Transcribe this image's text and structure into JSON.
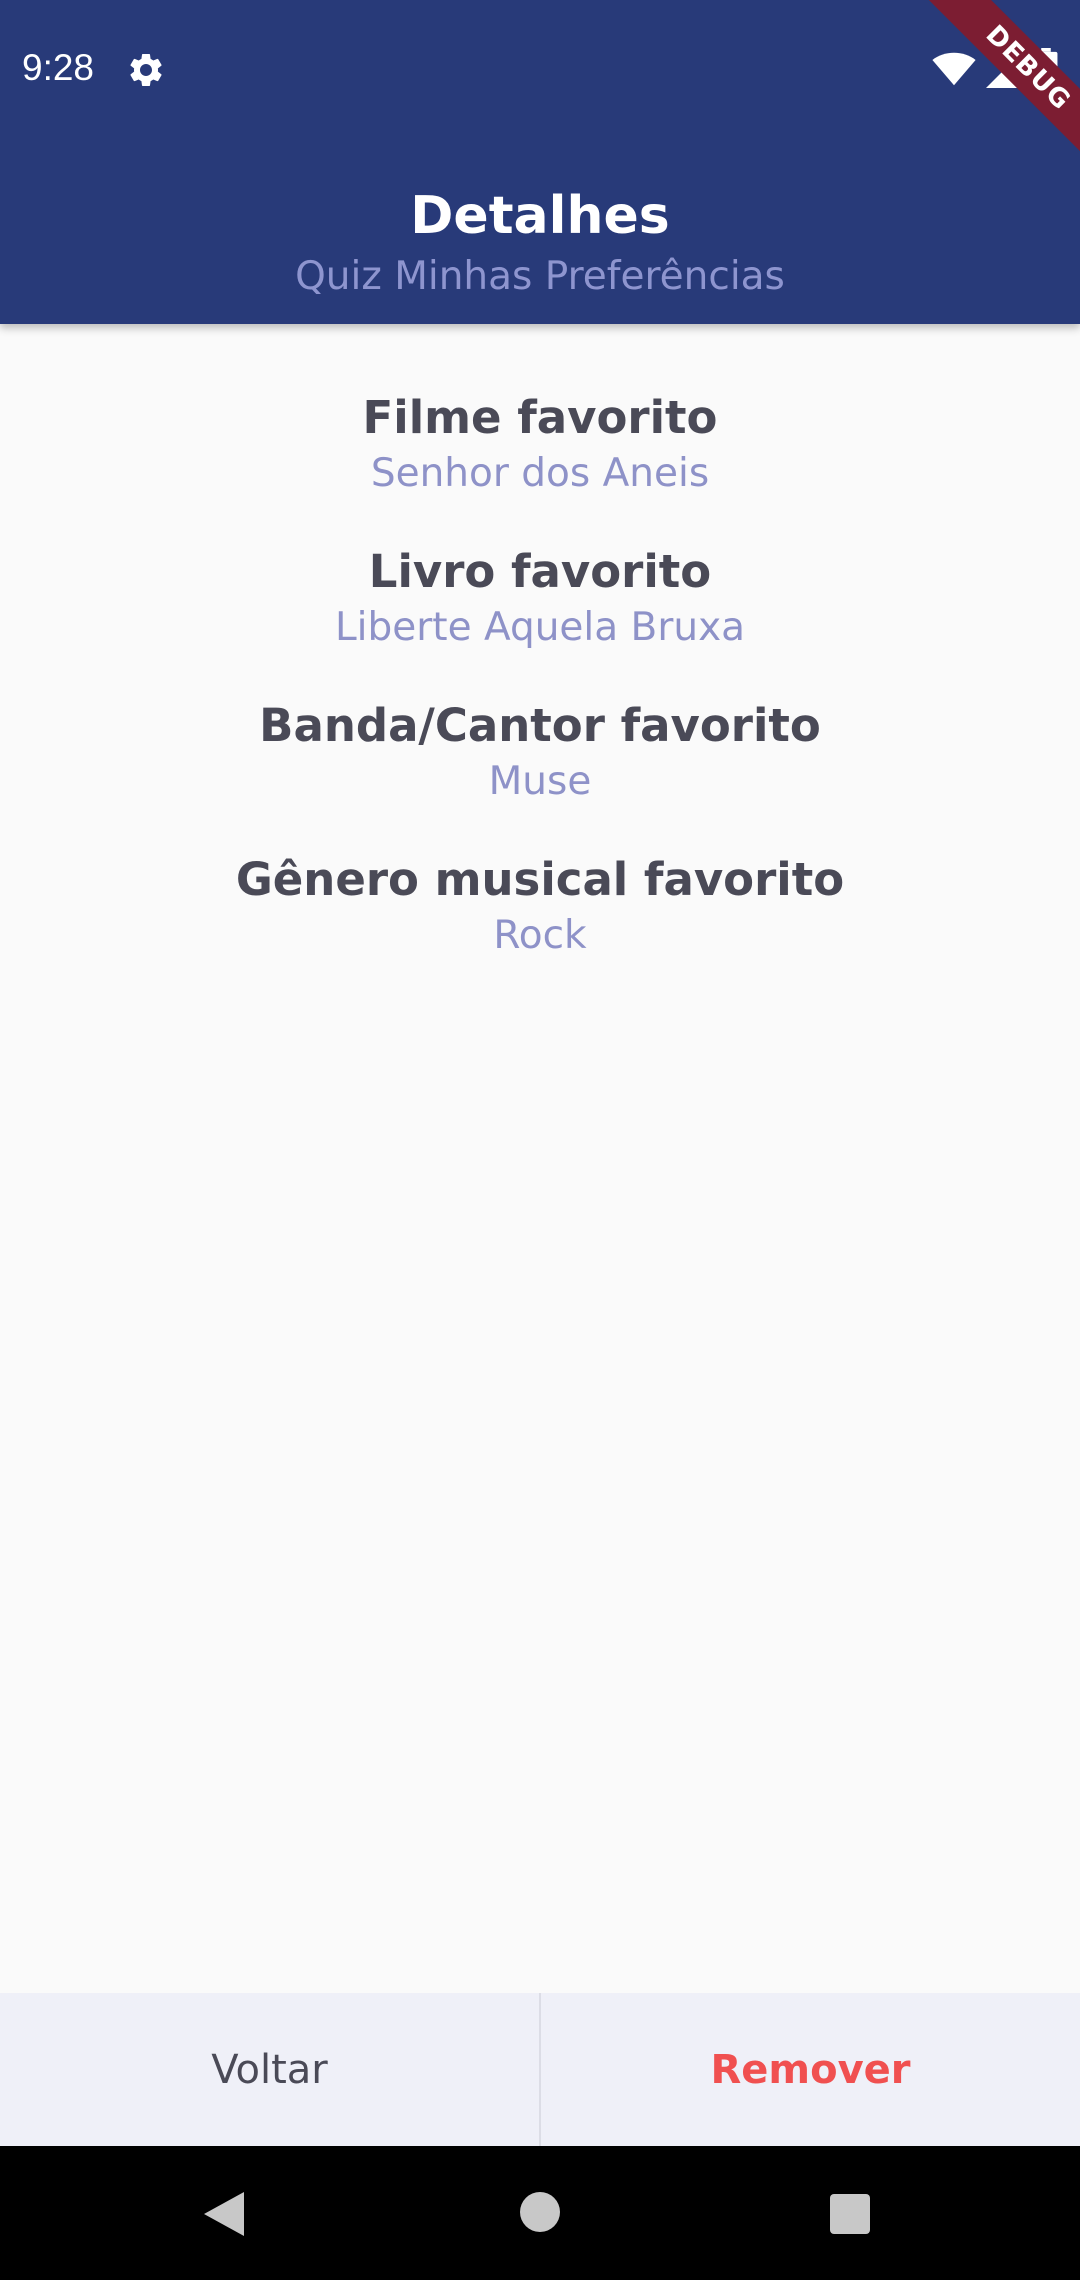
{
  "status_bar": {
    "time": "9:28",
    "icons": [
      "settings-icon",
      "wifi-icon",
      "signal-icon",
      "battery-icon"
    ]
  },
  "debug_banner": "DEBUG",
  "header": {
    "title": "Detalhes",
    "subtitle": "Quiz Minhas Preferências"
  },
  "details": [
    {
      "label": "Filme favorito",
      "value": "Senhor dos Aneis"
    },
    {
      "label": "Livro favorito",
      "value": "Liberte Aquela Bruxa"
    },
    {
      "label": "Banda/Cantor favorito",
      "value": "Muse"
    },
    {
      "label": "Gênero musical favorito",
      "value": "Rock"
    }
  ],
  "actions": {
    "back_label": "Voltar",
    "remove_label": "Remover"
  },
  "colors": {
    "header_bg": "#283a79",
    "label_text": "#4a4a57",
    "value_text": "#8e92c8",
    "remove_text": "#f05050"
  },
  "nav_bar": {
    "icons": [
      "back-icon",
      "home-icon",
      "recents-icon"
    ]
  }
}
